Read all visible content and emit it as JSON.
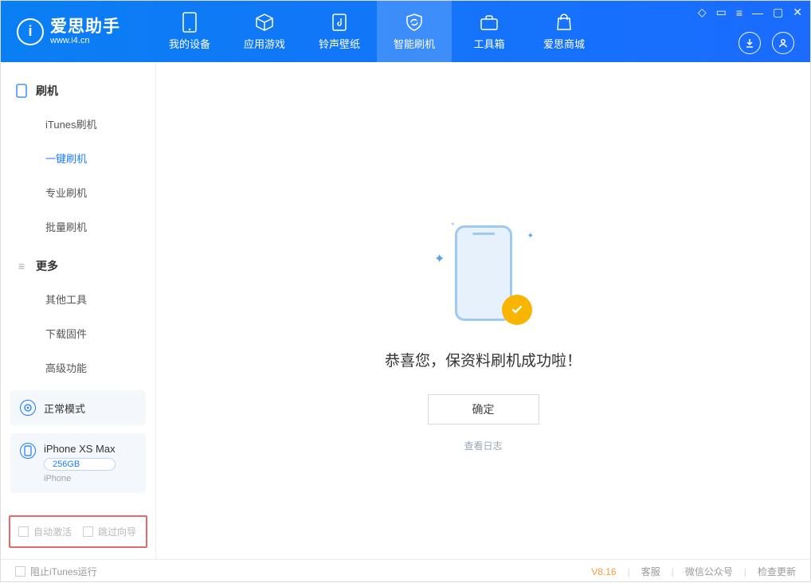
{
  "logo": {
    "title": "爱思助手",
    "sub": "www.i4.cn",
    "letter": "i"
  },
  "tabs": [
    {
      "id": "device",
      "label": "我的设备"
    },
    {
      "id": "apps",
      "label": "应用游戏"
    },
    {
      "id": "ring",
      "label": "铃声壁纸"
    },
    {
      "id": "flash",
      "label": "智能刷机",
      "active": true
    },
    {
      "id": "tools",
      "label": "工具箱"
    },
    {
      "id": "store",
      "label": "爱思商城"
    }
  ],
  "sidebar": {
    "section1_title": "刷机",
    "items1": [
      {
        "label": "iTunes刷机"
      },
      {
        "label": "一键刷机",
        "active": true
      },
      {
        "label": "专业刷机"
      },
      {
        "label": "批量刷机"
      }
    ],
    "section2_title": "更多",
    "items2": [
      {
        "label": "其他工具"
      },
      {
        "label": "下载固件"
      },
      {
        "label": "高级功能"
      }
    ]
  },
  "device_mode_card": "正常模式",
  "device_info": {
    "name": "iPhone XS Max",
    "capacity": "256GB",
    "subtype": "iPhone"
  },
  "bottom_checks": {
    "auto_activate": "自动激活",
    "skip_guide": "跳过向导"
  },
  "main": {
    "message": "恭喜您，保资料刷机成功啦！",
    "ok": "确定",
    "view_log": "查看日志"
  },
  "status": {
    "block_itunes": "阻止iTunes运行",
    "version": "V8.16",
    "links": [
      "客服",
      "微信公众号",
      "检查更新"
    ]
  },
  "icons": {
    "download": "⬇",
    "user": "◯",
    "shirt": "◇",
    "book": "▭",
    "list": "≡",
    "min": "—",
    "max": "▢",
    "close": "✕"
  }
}
